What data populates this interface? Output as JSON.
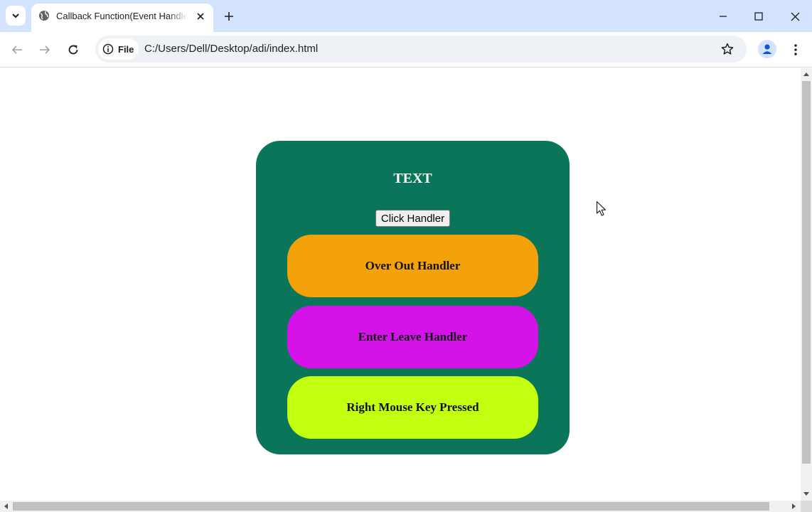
{
  "browser": {
    "tab": {
      "title": "Callback Function(Event Handler)",
      "favicon": "globe-icon"
    },
    "address_bar": {
      "chip_label": "File",
      "url": "C:/Users/Dell/Desktop/adi/index.html"
    },
    "icons": {
      "tab_search": "chevron-down-icon",
      "tab_close": "close-icon",
      "new_tab": "plus-icon",
      "minimize": "minimize-icon",
      "maximize": "maximize-icon",
      "close_window": "close-icon",
      "back": "back-arrow-icon",
      "forward": "forward-arrow-icon",
      "reload": "reload-icon",
      "site_info": "info-icon",
      "bookmark": "star-icon",
      "profile": "person-icon",
      "menu": "kebab-menu-icon"
    },
    "colors": {
      "tabstrip": "#d3e3fd",
      "omnibox": "#eef1f6"
    }
  },
  "page": {
    "heading": "TEXT",
    "click_button_label": "Click Handler",
    "boxes": [
      {
        "label": "Over Out Handler",
        "color": "#f4a20a"
      },
      {
        "label": "Enter Leave Handler",
        "color": "#d413e8"
      },
      {
        "label": "Right Mouse Key Pressed",
        "color": "#c3ff10"
      }
    ],
    "card_color": "#0b7559"
  }
}
